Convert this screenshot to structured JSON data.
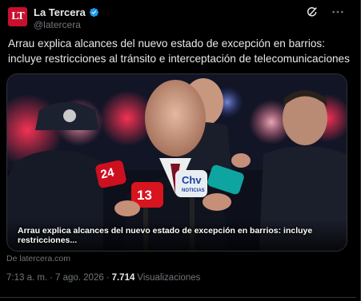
{
  "account": {
    "avatar_text": "LT",
    "display_name": "La Tercera",
    "handle": "@latercera",
    "verified_icon": "verified-badge-icon"
  },
  "actions": {
    "grok_icon": "grok-icon",
    "more_icon": "more-options-icon"
  },
  "post": {
    "text": "Arrau explica alcances del nuevo estado de excepción en barrios: incluye restricciones al tránsito e interceptación de telecomunicaciones"
  },
  "card": {
    "caption": "Arrau explica alcances del nuevo estado de excepción en barrios: incluye restricciones...",
    "source": "De latercera.com",
    "mic_labels": {
      "mic_24": "24",
      "mic_13": "13",
      "mic_chv": "Chv",
      "mic_chv_sub": "NOTICIAS"
    }
  },
  "meta": {
    "time": "7:13 a. m.",
    "separator": "·",
    "date": "7 ago. 2026",
    "separator2": "·",
    "views_count": "7.714",
    "views_label": "Visualizaciones"
  },
  "colors": {
    "avatar_bg": "#c8102e",
    "verified": "#1d9bf0",
    "text_primary": "#e7e9ea",
    "text_secondary": "#71767b",
    "border": "#2f3336"
  }
}
